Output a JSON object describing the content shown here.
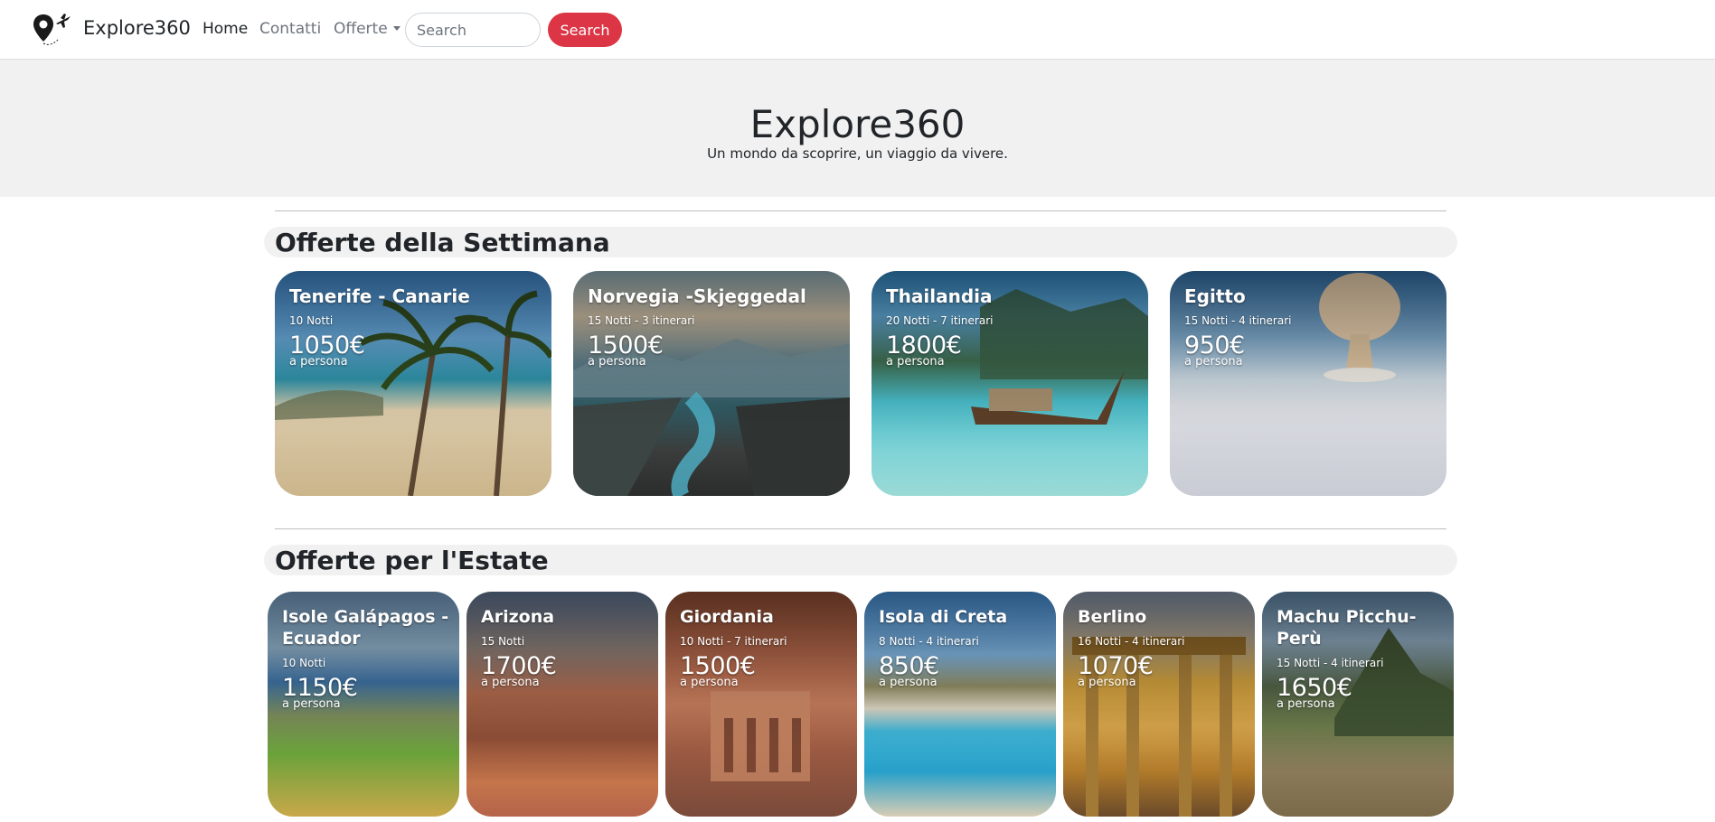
{
  "navbar": {
    "brand": "Explore360",
    "links": {
      "home": "Home",
      "contatti": "Contatti",
      "offerte": "Offerte"
    },
    "search_placeholder": "Search",
    "search_button": "Search"
  },
  "hero": {
    "title": "Explore360",
    "subtitle": "Un mondo da scoprire, un viaggio da vivere."
  },
  "weekly": {
    "title": "Offerte della Settimana",
    "cards": [
      {
        "title": "Tenerife - Canarie",
        "nights": "10 Notti",
        "price": "1050€",
        "per": "a persona"
      },
      {
        "title": "Norvegia -Skjeggedal",
        "nights": "15 Notti - 3 itinerari",
        "price": "1500€",
        "per": "a persona"
      },
      {
        "title": "Thailandia",
        "nights": "20 Notti - 7 itinerari",
        "price": "1800€",
        "per": "a persona"
      },
      {
        "title": "Egitto",
        "nights": "15 Notti - 4 itinerari",
        "price": "950€",
        "per": "a persona"
      }
    ]
  },
  "summer": {
    "title": "Offerte per l'Estate",
    "cards": [
      {
        "title": "Isole Galápagos - Ecuador",
        "nights": "10 Notti",
        "price": "1150€",
        "per": "a persona"
      },
      {
        "title": "Arizona",
        "nights": "15 Notti",
        "price": "1700€",
        "per": "a persona"
      },
      {
        "title": "Giordania",
        "nights": "10 Notti - 7 itinerari",
        "price": "1500€",
        "per": "a persona"
      },
      {
        "title": "Isola di Creta",
        "nights": "8 Notti - 4 itinerari",
        "price": "850€",
        "per": "a persona"
      },
      {
        "title": "Berlino",
        "nights": "16 Notti - 4 itinerari",
        "price": "1070€",
        "per": "a persona"
      },
      {
        "title": "Machu Picchu- Perù",
        "nights": "15 Notti - 4 itinerari",
        "price": "1650€",
        "per": "a persona"
      }
    ]
  },
  "colors": {
    "accent": "#dc3545",
    "hero_bg": "#f1f1f1"
  }
}
